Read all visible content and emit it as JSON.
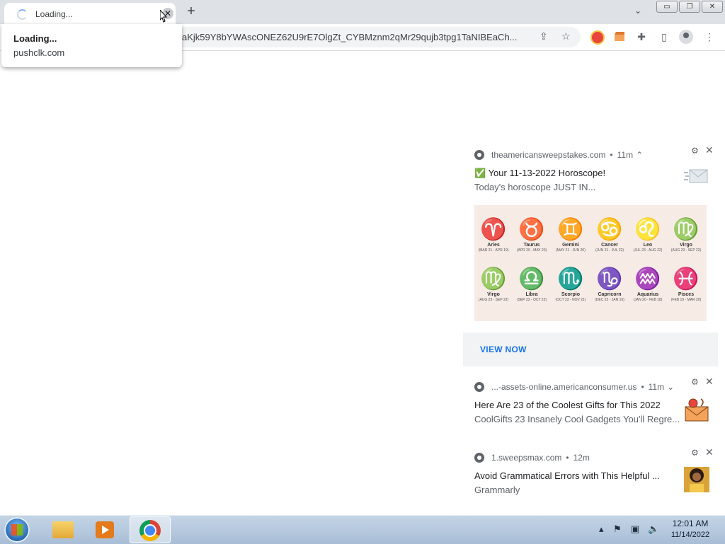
{
  "browser": {
    "tab_title": "Loading...",
    "tab_close": "✕",
    "new_tab": "+",
    "tab_search": "⌄",
    "address": "aKjk59Y8bYWAscONEZ62U9rE7OlgZt_CYBMznm2qMr29qujb3tpg1TaNIBEaCh...",
    "window_buttons": {
      "minimize": "▭",
      "maximize": "❐",
      "close": "✕"
    }
  },
  "hover_card": {
    "title": "Loading...",
    "domain": "pushclk.com"
  },
  "notifications": [
    {
      "source": "theamericansweepstakes.com",
      "age": "11m",
      "chevron": "⌃",
      "title": "✅ Your 11-13-2022 Horoscope!",
      "body": "Today's horoscope JUST IN...",
      "action": "VIEW NOW"
    },
    {
      "source": "...-assets-online.americanconsumer.us",
      "age": "11m",
      "chevron": "⌄",
      "title": "Here Are 23 of the Coolest Gifts for This 2022",
      "body": "CoolGifts 23 Insanely Cool Gadgets You'll Regre..."
    },
    {
      "source": "1.sweepsmax.com",
      "age": "12m",
      "chevron": "",
      "title": "Avoid Grammatical Errors with This Helpful ...",
      "body": "Grammarly"
    }
  ],
  "zodiac": [
    {
      "glyph": "♈",
      "name": "Aries",
      "dates": "(MAR 21 - APR 19)"
    },
    {
      "glyph": "♉",
      "name": "Taurus",
      "dates": "(APR 20 - MAY 20)"
    },
    {
      "glyph": "♊",
      "name": "Gemini",
      "dates": "(MAY 21 - JUN 20)"
    },
    {
      "glyph": "♋",
      "name": "Cancer",
      "dates": "(JUN 21 - JUL 22)"
    },
    {
      "glyph": "♌",
      "name": "Leo",
      "dates": "(JUL 23 - AUG 22)"
    },
    {
      "glyph": "♍",
      "name": "Virgo",
      "dates": "(AUG 23 - SEP 22)"
    },
    {
      "glyph": "♍",
      "name": "Virgo",
      "dates": "(AUG 23 - SEP 22)"
    },
    {
      "glyph": "♎",
      "name": "Libra",
      "dates": "(SEP 23 - OCT 22)"
    },
    {
      "glyph": "♏",
      "name": "Scorpio",
      "dates": "(OCT 23 - NOV 21)"
    },
    {
      "glyph": "♑",
      "name": "Capricorn",
      "dates": "(DEC 22 - JAN 19)"
    },
    {
      "glyph": "♒",
      "name": "Aquarius",
      "dates": "(JAN 20 - FEB 18)"
    },
    {
      "glyph": "♓",
      "name": "Pisces",
      "dates": "(FEB 19 - MAR 20)"
    }
  ],
  "taskbar": {
    "time": "12:01 AM",
    "date": "11/14/2022",
    "tray_icons": [
      "chevron-up-icon",
      "flag-icon",
      "network-icon",
      "volume-icon"
    ]
  },
  "colors": {
    "accent_link": "#1a73e8",
    "tab_strip": "#dee1e6",
    "taskbar": "#b4c8de"
  }
}
